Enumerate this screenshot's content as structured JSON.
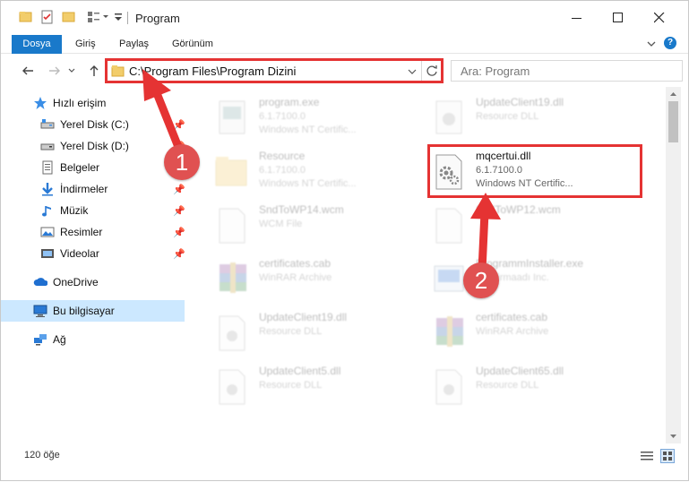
{
  "window": {
    "title": "Program"
  },
  "ribbon": {
    "tabs": [
      "Dosya",
      "Giriş",
      "Paylaş",
      "Görünüm"
    ]
  },
  "address": {
    "path": "C:\\Program Files\\Program Dizini"
  },
  "search": {
    "placeholder": "Ara: Program"
  },
  "sidebar": {
    "items": [
      {
        "label": "Hızlı erişim",
        "icon": "star-icon"
      },
      {
        "label": "Yerel Disk (C:)",
        "icon": "drive-icon",
        "pinned": true
      },
      {
        "label": "Yerel Disk (D:)",
        "icon": "drive-icon",
        "pinned": true
      },
      {
        "label": "Belgeler",
        "icon": "documents-icon",
        "pinned": true
      },
      {
        "label": "İndirmeler",
        "icon": "download-icon",
        "pinned": true
      },
      {
        "label": "Müzik",
        "icon": "music-icon",
        "pinned": true
      },
      {
        "label": "Resimler",
        "icon": "pictures-icon",
        "pinned": true
      },
      {
        "label": "Videolar",
        "icon": "videos-icon",
        "pinned": true
      },
      {
        "label": "OneDrive",
        "icon": "cloud-icon"
      },
      {
        "label": "Bu bilgisayar",
        "icon": "computer-icon",
        "selected": true
      },
      {
        "label": "Ağ",
        "icon": "network-icon"
      }
    ]
  },
  "files": [
    {
      "name": "program.exe",
      "line2": "6.1.7100.0",
      "line3": "Windows NT Certific...",
      "icon": "exe-icon"
    },
    {
      "name": "UpdateClient19.dll",
      "line2": "Resource DLL",
      "line3": "",
      "icon": "dll-icon"
    },
    {
      "name": "Resource",
      "line2": "6.1.7100.0",
      "line3": "Windows NT Certific...",
      "icon": "folder-icon"
    },
    {
      "name": "mqcertui.dll",
      "line2": "6.1.7100.0",
      "line3": "Windows NT Certific...",
      "icon": "dll-gear-icon"
    },
    {
      "name": "SndToWP14.wcm",
      "line2": "WCM File",
      "line3": "",
      "icon": "file-icon"
    },
    {
      "name": "SndToWP12.wcm",
      "line2": "",
      "line3": "",
      "icon": "file-icon"
    },
    {
      "name": "certificates.cab",
      "line2": "WinRAR Archive",
      "line3": "",
      "icon": "archive-icon"
    },
    {
      "name": "ProgrammInstaller.exe",
      "line2": "SY Firmaadı Inc.",
      "line3": "",
      "icon": "installer-icon"
    },
    {
      "name": "UpdateClient19.dll",
      "line2": "Resource DLL",
      "line3": "",
      "icon": "dll-icon"
    },
    {
      "name": "certificates.cab",
      "line2": "WinRAR Archive",
      "line3": "",
      "icon": "archive-icon"
    },
    {
      "name": "UpdateClient5.dll",
      "line2": "Resource DLL",
      "line3": "",
      "icon": "dll-icon"
    },
    {
      "name": "UpdateClient65.dll",
      "line2": "Resource DLL",
      "line3": "",
      "icon": "dll-icon"
    }
  ],
  "status": {
    "count": "120 öğe"
  },
  "annotations": {
    "badge1": "1",
    "badge2": "2",
    "color": "#e53333"
  }
}
